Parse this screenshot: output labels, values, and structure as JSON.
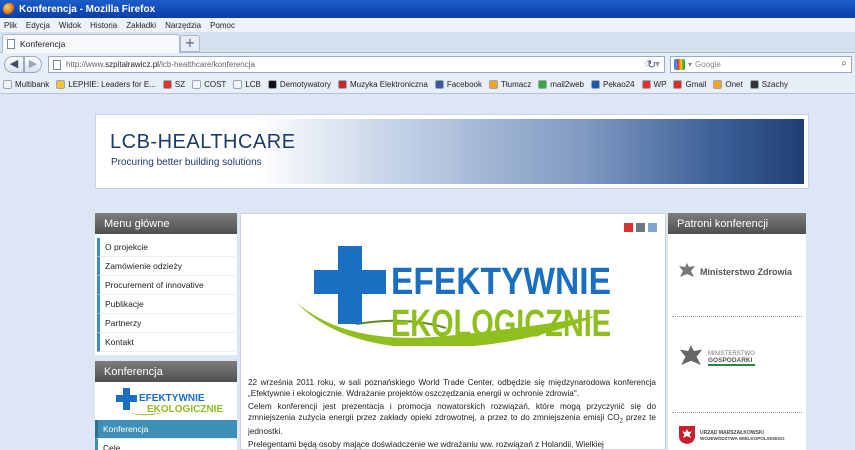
{
  "window": {
    "title": "Konferencja - Mozilla Firefox"
  },
  "menubar": [
    "Plik",
    "Edycja",
    "Widok",
    "Historia",
    "Zakładki",
    "Narzędzia",
    "Pomoc"
  ],
  "tab": {
    "label": "Konferencja"
  },
  "url": {
    "prefix": "http://www.",
    "domain": "szpitalrawicz.pl",
    "path": "/lcb-healthcare/konferencja"
  },
  "search": {
    "placeholder": "Google"
  },
  "bookmarks": [
    {
      "label": "Multibank",
      "color": "#f2f4f7"
    },
    {
      "label": "LEPHIE: Leaders for E...",
      "color": "#f3c43a"
    },
    {
      "label": "SZ",
      "color": "#d8362a"
    },
    {
      "label": "COST",
      "color": "#f2f4f7"
    },
    {
      "label": "LCB",
      "color": "#f2f4f7"
    },
    {
      "label": "Demotywatory",
      "color": "#111111"
    },
    {
      "label": "Muzyka Elektroniczna",
      "color": "#c8262a"
    },
    {
      "label": "Facebook",
      "color": "#3b5998"
    },
    {
      "label": "Tłumacz",
      "color": "#f3a325"
    },
    {
      "label": "mail2web",
      "color": "#3aa640"
    },
    {
      "label": "Pekao24",
      "color": "#1e5aa8"
    },
    {
      "label": "WP",
      "color": "#e03030"
    },
    {
      "label": "Gmail",
      "color": "#d93025"
    },
    {
      "label": "Onet",
      "color": "#f3a325"
    },
    {
      "label": "Szachy",
      "color": "#333333"
    }
  ],
  "banner": {
    "title": "LCB-HEALTHCARE",
    "subtitle": "Procuring better building solutions"
  },
  "left": {
    "menu_title": "Menu główne",
    "menu": [
      "O projekcie",
      "Zamówienie odzieży",
      "Procurement of innovative",
      "Publikacje",
      "Partnerzy",
      "Kontakt"
    ],
    "conf_title": "Konferencja",
    "conf_items": [
      "Konferencja",
      "Cele"
    ]
  },
  "logo": {
    "line1": "EFEKTYWNIE",
    "line2": "EKOLOGICZNIE"
  },
  "article": {
    "p1": "22 września 2011 roku, w sali poznańskiego World Trade Center, odbędzie się międzynarodowa konferencja „Efektywnie i ekologicznie. Wdrażanie projektów oszczędzania energii w ochronie zdrowia\".",
    "p2a": "Celem konferencji jest prezentacja i promocja nowatorskich rozwiązań, które mogą przyczynić się do zmniejszenia zużycia energii przez zakłady opieki zdrowotnej, a przez to do zmniejszenia emisji CO",
    "p2sub": "2",
    "p2b": " przez te jednostki.",
    "p3": "Prelegentami będą osoby mające doświadczenie we wdrażaniu ww. rozwiązań z Holandii, Wielkiej"
  },
  "right": {
    "title": "Patroni konferencji",
    "patron1": "Ministerstwo Zdrowia",
    "patron2a": "MINISTERSTWO",
    "patron2b": "GOSPODARKI",
    "patron3a": "URZĄD MARSZAŁKOWSKI",
    "patron3b": "WOJEWÓDZTWA WIELKOPOLSKIEGO"
  },
  "colors": {
    "accent": "#3d8fb5",
    "title_bar": "#1c5dc8",
    "logo_blue": "#1a6fc0",
    "logo_green": "#8fbf1e"
  }
}
